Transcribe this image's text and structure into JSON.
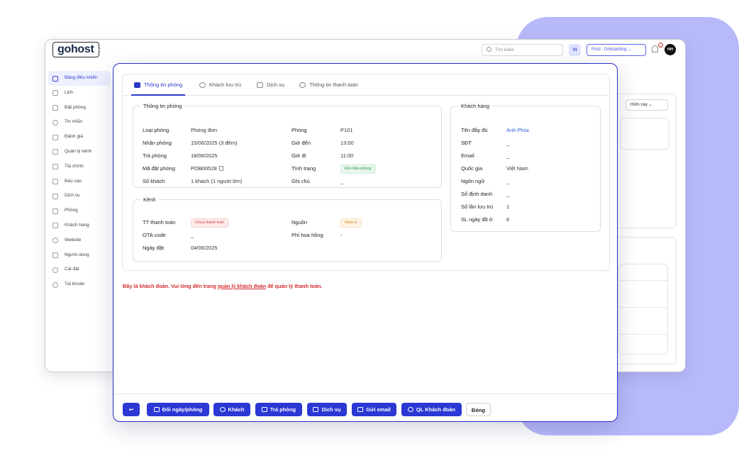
{
  "app": {
    "logo": "gohost",
    "collapse_icon": "chevron-left-icon",
    "search_placeholder": "Tìm kiếm",
    "lang": "VI",
    "env": "Prod - Onboarding",
    "bell_count": "1",
    "avatar": "HH",
    "range_select": "Hôm nay"
  },
  "sidebar": {
    "items": [
      {
        "label": "Bảng điều khiển",
        "icon": "dashboard-icon",
        "active": true
      },
      {
        "label": "Lịch",
        "icon": "calendar-icon"
      },
      {
        "label": "Đặt phòng",
        "icon": "book-icon"
      },
      {
        "label": "Tin nhắn",
        "icon": "chat-icon"
      },
      {
        "label": "Đánh giá",
        "icon": "star-icon"
      },
      {
        "label": "Quản lý kênh",
        "icon": "share-icon"
      },
      {
        "label": "Tài chính",
        "icon": "money-icon"
      },
      {
        "label": "Báo cáo",
        "icon": "chart-icon"
      },
      {
        "label": "Dịch vụ",
        "icon": "service-icon"
      },
      {
        "label": "Phòng",
        "icon": "building-icon"
      },
      {
        "label": "Khách hàng",
        "icon": "customers-icon"
      },
      {
        "label": "Website",
        "icon": "globe-icon"
      },
      {
        "label": "Người dùng",
        "icon": "users-icon"
      },
      {
        "label": "Cài đặt",
        "icon": "gear-icon"
      },
      {
        "label": "Tài khoản",
        "icon": "user-icon"
      }
    ]
  },
  "modal": {
    "tabs": [
      {
        "label": "Thông tin phòng",
        "icon": "book-icon",
        "active": true
      },
      {
        "label": "Khách lưu trú",
        "icon": "guests-icon"
      },
      {
        "label": "Dịch vụ",
        "icon": "sparkle-icon"
      },
      {
        "label": "Thông tin thanh toán",
        "icon": "dollar-icon"
      }
    ],
    "room_info": {
      "title": "Thông tin phòng",
      "left": [
        {
          "label": "Loại phòng",
          "value": "Phòng đơn"
        },
        {
          "label": "Nhận phòng",
          "value": "15/06/2025 (3 đêm)"
        },
        {
          "label": "Trả phòng",
          "value": "18/06/2025"
        },
        {
          "label": "Mã đặt phòng",
          "value": "POB00528"
        },
        {
          "label": "Số khách",
          "value": "1 khách (1 người lớn)"
        }
      ],
      "right": [
        {
          "label": "Phòng",
          "value": "P101"
        },
        {
          "label": "Giờ đến",
          "value": "13:00"
        },
        {
          "label": "Giờ đi",
          "value": "11:00"
        },
        {
          "label": "Tình trạng",
          "value": "Đã nhận phòng"
        },
        {
          "label": "Ghi chú",
          "value": "_"
        }
      ]
    },
    "channel": {
      "title": "Kênh",
      "left": [
        {
          "label": "TT thanh toán",
          "value": "Chưa thanh toán"
        },
        {
          "label": "OTA code",
          "value": "_"
        },
        {
          "label": "Ngày đặt",
          "value": "04/06/2025"
        }
      ],
      "right": [
        {
          "label": "Nguồn",
          "value": "Walk-in"
        },
        {
          "label": "Phí hoa hồng",
          "value": "-"
        }
      ]
    },
    "customer": {
      "title": "Khách hàng",
      "rows": [
        {
          "label": "Tên đầy đủ",
          "value": "Anh Phúc"
        },
        {
          "label": "SĐT",
          "value": "_"
        },
        {
          "label": "Email",
          "value": "_"
        },
        {
          "label": "Quốc gia",
          "value": "Việt Nam"
        },
        {
          "label": "Ngôn ngữ",
          "value": "_"
        },
        {
          "label": "Số định danh",
          "value": "_"
        },
        {
          "label": "Số lần lưu trú",
          "value": "1"
        },
        {
          "label": "SL ngày đã ở",
          "value": "6"
        }
      ]
    },
    "warning": {
      "before": "Đây là khách đoàn. Vui lòng đến trang ",
      "link": "quản lý khách đoàn",
      "after": " để quản lý thanh toán."
    },
    "footer": {
      "buttons": [
        {
          "label": "",
          "icon": "back-icon"
        },
        {
          "label": "Đổi ngày/phòng",
          "icon": "edit-icon"
        },
        {
          "label": "Khách",
          "icon": "add-user-icon"
        },
        {
          "label": "Trả phòng",
          "icon": "checkout-icon"
        },
        {
          "label": "Dịch vụ",
          "icon": "sparkle-icon"
        },
        {
          "label": "Gửi email",
          "icon": "mail-icon"
        },
        {
          "label": "QL Khách đoàn",
          "icon": "group-icon"
        },
        {
          "label": "Đóng",
          "icon": ""
        }
      ]
    }
  }
}
